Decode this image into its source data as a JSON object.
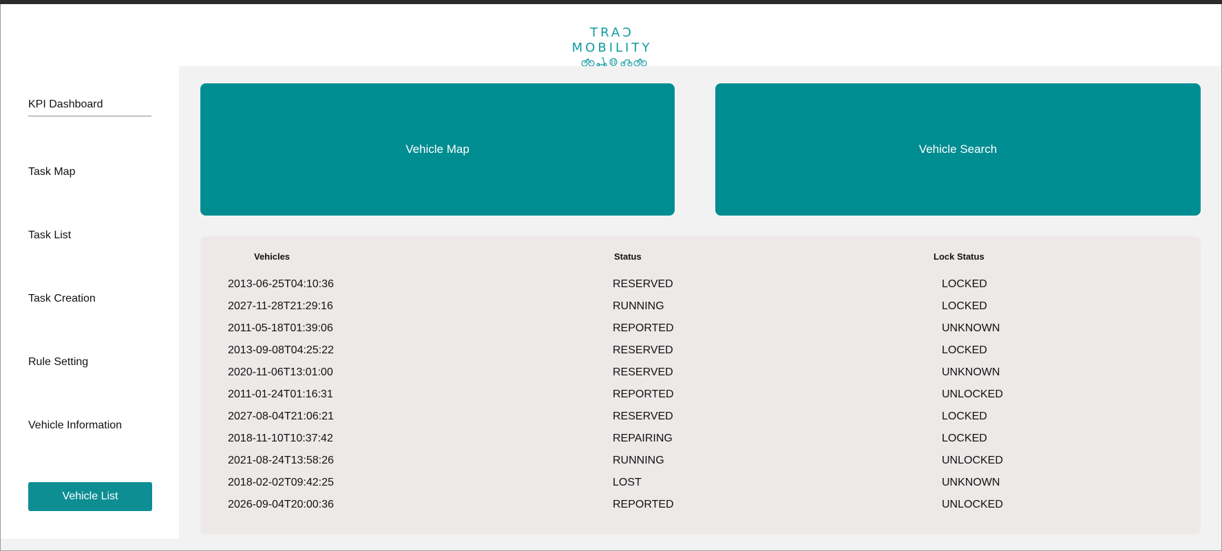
{
  "brand": {
    "logo_text": "TRAƆ MOBILITY",
    "accent_color": "#0d8e93",
    "logo_icons": [
      "bicycle-icon",
      "scooter-icon",
      "battery-icon",
      "moped-icon",
      "bicycle-icon"
    ]
  },
  "sidebar": {
    "items": [
      {
        "label": "KPI Dashboard"
      },
      {
        "label": "Task Map"
      },
      {
        "label": "Task List"
      },
      {
        "label": "Task Creation"
      },
      {
        "label": "Rule Setting"
      },
      {
        "label": "Vehicle Information"
      }
    ],
    "active_button": "Vehicle List"
  },
  "main": {
    "buttons": {
      "vehicle_map": "Vehicle Map",
      "vehicle_search": "Vehicle Search"
    },
    "table": {
      "headers": {
        "vehicles": "Vehicles",
        "status": "Status",
        "lock_status": "Lock Status"
      },
      "rows": [
        {
          "vehicle": "2013-06-25T04:10:36",
          "status": "RESERVED",
          "lock": "LOCKED"
        },
        {
          "vehicle": "2027-11-28T21:29:16",
          "status": "RUNNING",
          "lock": "LOCKED"
        },
        {
          "vehicle": "2011-05-18T01:39:06",
          "status": "REPORTED",
          "lock": "UNKNOWN"
        },
        {
          "vehicle": "2013-09-08T04:25:22",
          "status": "RESERVED",
          "lock": "LOCKED"
        },
        {
          "vehicle": "2020-11-06T13:01:00",
          "status": "RESERVED",
          "lock": "UNKNOWN"
        },
        {
          "vehicle": "2011-01-24T01:16:31",
          "status": "REPORTED",
          "lock": "UNLOCKED"
        },
        {
          "vehicle": "2027-08-04T21:06:21",
          "status": "RESERVED",
          "lock": "LOCKED"
        },
        {
          "vehicle": "2018-11-10T10:37:42",
          "status": "REPAIRING",
          "lock": "LOCKED"
        },
        {
          "vehicle": "2021-08-24T13:58:26",
          "status": "RUNNING",
          "lock": "UNLOCKED"
        },
        {
          "vehicle": "2018-02-02T09:42:25",
          "status": "LOST",
          "lock": "UNKNOWN"
        },
        {
          "vehicle": "2026-09-04T20:00:36",
          "status": "REPORTED",
          "lock": "UNLOCKED"
        }
      ]
    }
  }
}
